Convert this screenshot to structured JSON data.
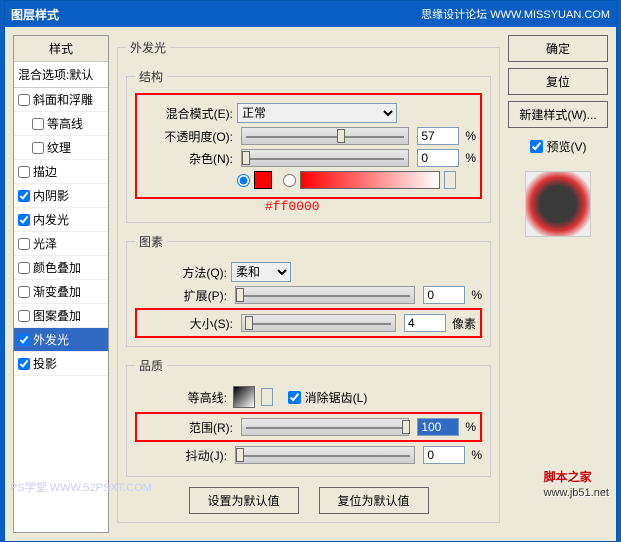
{
  "title": "图层样式",
  "title_right": "思缘设计论坛  WWW.MISSYUAN.COM",
  "sidebar": {
    "header": "样式",
    "sub": "混合选项:默认",
    "items": [
      {
        "label": "斜面和浮雕",
        "checked": false,
        "indent": false
      },
      {
        "label": "等高线",
        "checked": false,
        "indent": true
      },
      {
        "label": "纹理",
        "checked": false,
        "indent": true
      },
      {
        "label": "描边",
        "checked": false,
        "indent": false
      },
      {
        "label": "内阴影",
        "checked": true,
        "indent": false
      },
      {
        "label": "内发光",
        "checked": true,
        "indent": false
      },
      {
        "label": "光泽",
        "checked": false,
        "indent": false
      },
      {
        "label": "颜色叠加",
        "checked": false,
        "indent": false
      },
      {
        "label": "渐变叠加",
        "checked": false,
        "indent": false
      },
      {
        "label": "图案叠加",
        "checked": false,
        "indent": false
      },
      {
        "label": "外发光",
        "checked": true,
        "indent": false,
        "active": true
      },
      {
        "label": "投影",
        "checked": true,
        "indent": false
      }
    ]
  },
  "main_title": "外发光",
  "structure": {
    "legend": "结构",
    "blend_label": "混合模式(E):",
    "blend_value": "正常",
    "opacity_label": "不透明度(O):",
    "opacity_value": "57",
    "noise_label": "杂色(N):",
    "noise_value": "0",
    "pct": "%",
    "color_code": "#ff0000"
  },
  "contour": {
    "legend": "图素",
    "method_label": "方法(Q):",
    "method_value": "柔和",
    "spread_label": "扩展(P):",
    "spread_value": "0",
    "size_label": "大小(S):",
    "size_value": "4",
    "size_unit": "像素",
    "pct": "%"
  },
  "quality": {
    "legend": "品质",
    "contour_label": "等高线:",
    "antialias_label": "消除锯齿(L)",
    "range_label": "范围(R):",
    "range_value": "100",
    "jitter_label": "抖动(J):",
    "jitter_value": "0",
    "pct": "%"
  },
  "buttons": {
    "ok": "确定",
    "cancel": "复位",
    "newstyle": "新建样式(W)...",
    "preview_label": "预览(V)",
    "set_default": "设置为默认值",
    "reset_default": "复位为默认值"
  },
  "watermark": {
    "text": "脚本之家",
    "url": "www.jb51.net"
  },
  "psxt": "PS学堂  WWW.52PSXT.COM"
}
